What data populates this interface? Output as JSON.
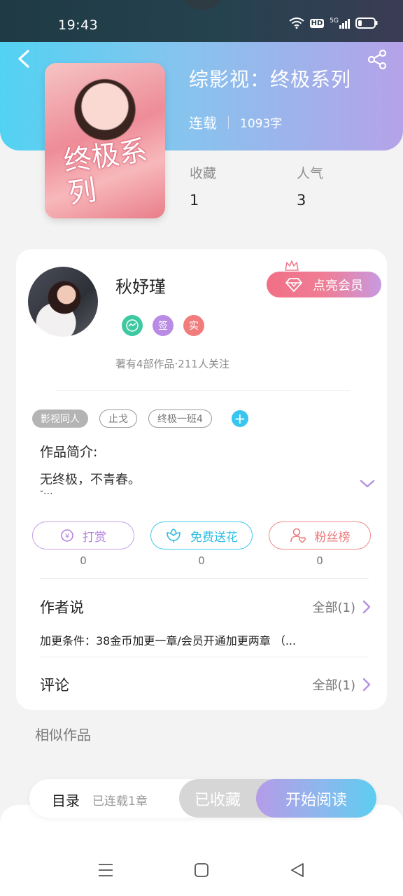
{
  "status_bar": {
    "time": "19:43",
    "hd_label": "HD",
    "network_label": "5G"
  },
  "book": {
    "title": "综影视：终极系列",
    "status": "连载",
    "word_count": "1093字",
    "cover_art_text": "终极系列",
    "stats": [
      {
        "label": "收藏",
        "value": "1"
      },
      {
        "label": "人气",
        "value": "3"
      }
    ]
  },
  "author": {
    "name": "秋妤瑾",
    "badges": [
      {
        "icon": "medal-icon",
        "label": "",
        "color": "#3ec9a2"
      },
      {
        "icon": "sign-badge-icon",
        "label": "签",
        "color": "#b98be5"
      },
      {
        "icon": "verified-badge-icon",
        "label": "实",
        "color": "#f07c7c"
      }
    ],
    "stats_text": "著有4部作品·211人关注",
    "vip_button": "点亮会员"
  },
  "tags": [
    "影视同人",
    "止戈",
    "终极一班4"
  ],
  "intro": {
    "title": "作品简介:",
    "text": "无终极，不青春。",
    "more": "-..."
  },
  "actions": [
    {
      "label": "打赏",
      "count": "0",
      "icon": "coin-icon"
    },
    {
      "label": "免费送花",
      "count": "0",
      "icon": "flower-icon"
    },
    {
      "label": "粉丝榜",
      "count": "0",
      "icon": "fan-user-icon"
    }
  ],
  "author_says": {
    "title": "作者说",
    "link": "全部(1)",
    "content": "加更条件：38金币加更一章/会员开通加更两章 （..."
  },
  "comments": {
    "title": "评论",
    "link": "全部(1)"
  },
  "similar": {
    "title": "相似作品"
  },
  "bottom_bar": {
    "toc": "目录",
    "toc_count": "已连载1章",
    "collected": "已收藏",
    "read": "开始阅读"
  },
  "colors": {
    "accent_blue": "#52d2f2",
    "accent_purple": "#b5a2e8",
    "vip_pink": "#f06f86"
  }
}
